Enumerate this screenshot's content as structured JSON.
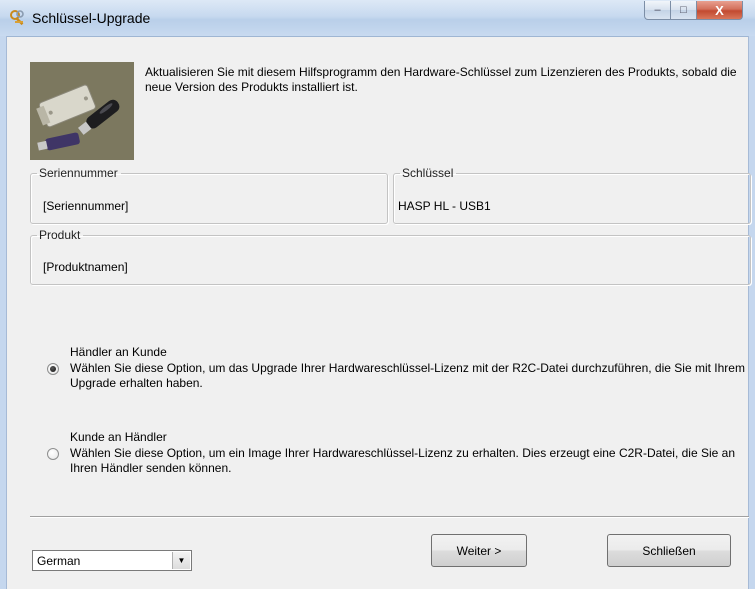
{
  "window": {
    "title": "Schlüssel-Upgrade",
    "controls": {
      "minimize": "–",
      "maximize": "□",
      "close": "X"
    }
  },
  "header": {
    "description": "Aktualisieren Sie mit diesem Hilfsprogramm den Hardware-Schlüssel zum Lizenzieren des Produkts, sobald die neue Version des Produkts installiert ist."
  },
  "groups": {
    "serial": {
      "legend": "Seriennummer",
      "value": "[Seriennummer]"
    },
    "key": {
      "legend": "Schlüssel",
      "value": "HASP HL - USB1"
    },
    "product": {
      "legend": "Produkt",
      "value": "[Produktnamen]"
    }
  },
  "options": [
    {
      "title": "Händler an Kunde",
      "description": "Wählen Sie diese Option, um das Upgrade Ihrer Hardwareschlüssel-Lizenz mit der R2C-Datei durchzuführen, die Sie mit Ihrem Upgrade erhalten haben.",
      "selected": true
    },
    {
      "title": "Kunde an Händler",
      "description": "Wählen Sie diese Option, um ein Image Ihrer Hardwareschlüssel-Lizenz zu erhalten. Dies erzeugt eine C2R-Datei, die Sie an Ihren Händler senden können.",
      "selected": false
    }
  ],
  "footer": {
    "language": "German",
    "dropdown_arrow": "▼",
    "next_label": "Weiter >",
    "close_label": "Schließen"
  },
  "icons": {
    "title_icon": "keys-icon",
    "device_image": "usb-dongles-photo"
  }
}
